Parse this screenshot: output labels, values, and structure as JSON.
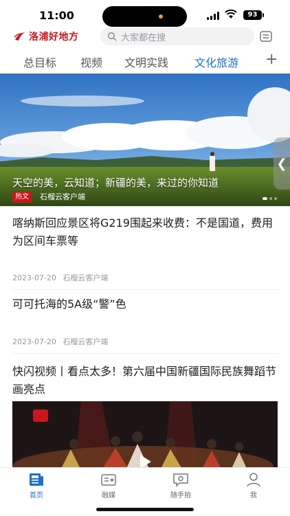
{
  "status": {
    "time": "11:00",
    "battery": "93"
  },
  "header": {
    "app_name": "洛浦好地方",
    "search_placeholder": "大家都在搜"
  },
  "tabs": [
    {
      "label": "总目标"
    },
    {
      "label": "视频"
    },
    {
      "label": "文明实践"
    },
    {
      "label": "文化旅游",
      "active": true
    }
  ],
  "hero": {
    "title": "天空的美，云知道；新疆的美，来过的你知道",
    "badge": "热文",
    "source": "石榴云客户端"
  },
  "articles": [
    {
      "title": "喀纳斯回应景区将G219围起来收费：不是国道，费用为区间车票等",
      "date": "2023-07-20",
      "source": "石榴云客户端"
    },
    {
      "title": "可可托海的5A级“警”色",
      "date": "2023-07-20",
      "source": "石榴云客户端"
    },
    {
      "title": "快闪视频丨看点太多！第六届中国新疆国际民族舞蹈节画亮点"
    }
  ],
  "tabbar": [
    {
      "label": "首页",
      "icon": "home-news-icon",
      "active": true
    },
    {
      "label": "融媒",
      "icon": "media-icon"
    },
    {
      "label": "随手拍",
      "icon": "camera-message-icon"
    },
    {
      "label": "我",
      "icon": "profile-icon"
    }
  ],
  "colors": {
    "brand_red": "#c8171e",
    "active_blue": "#1d6fc9"
  }
}
